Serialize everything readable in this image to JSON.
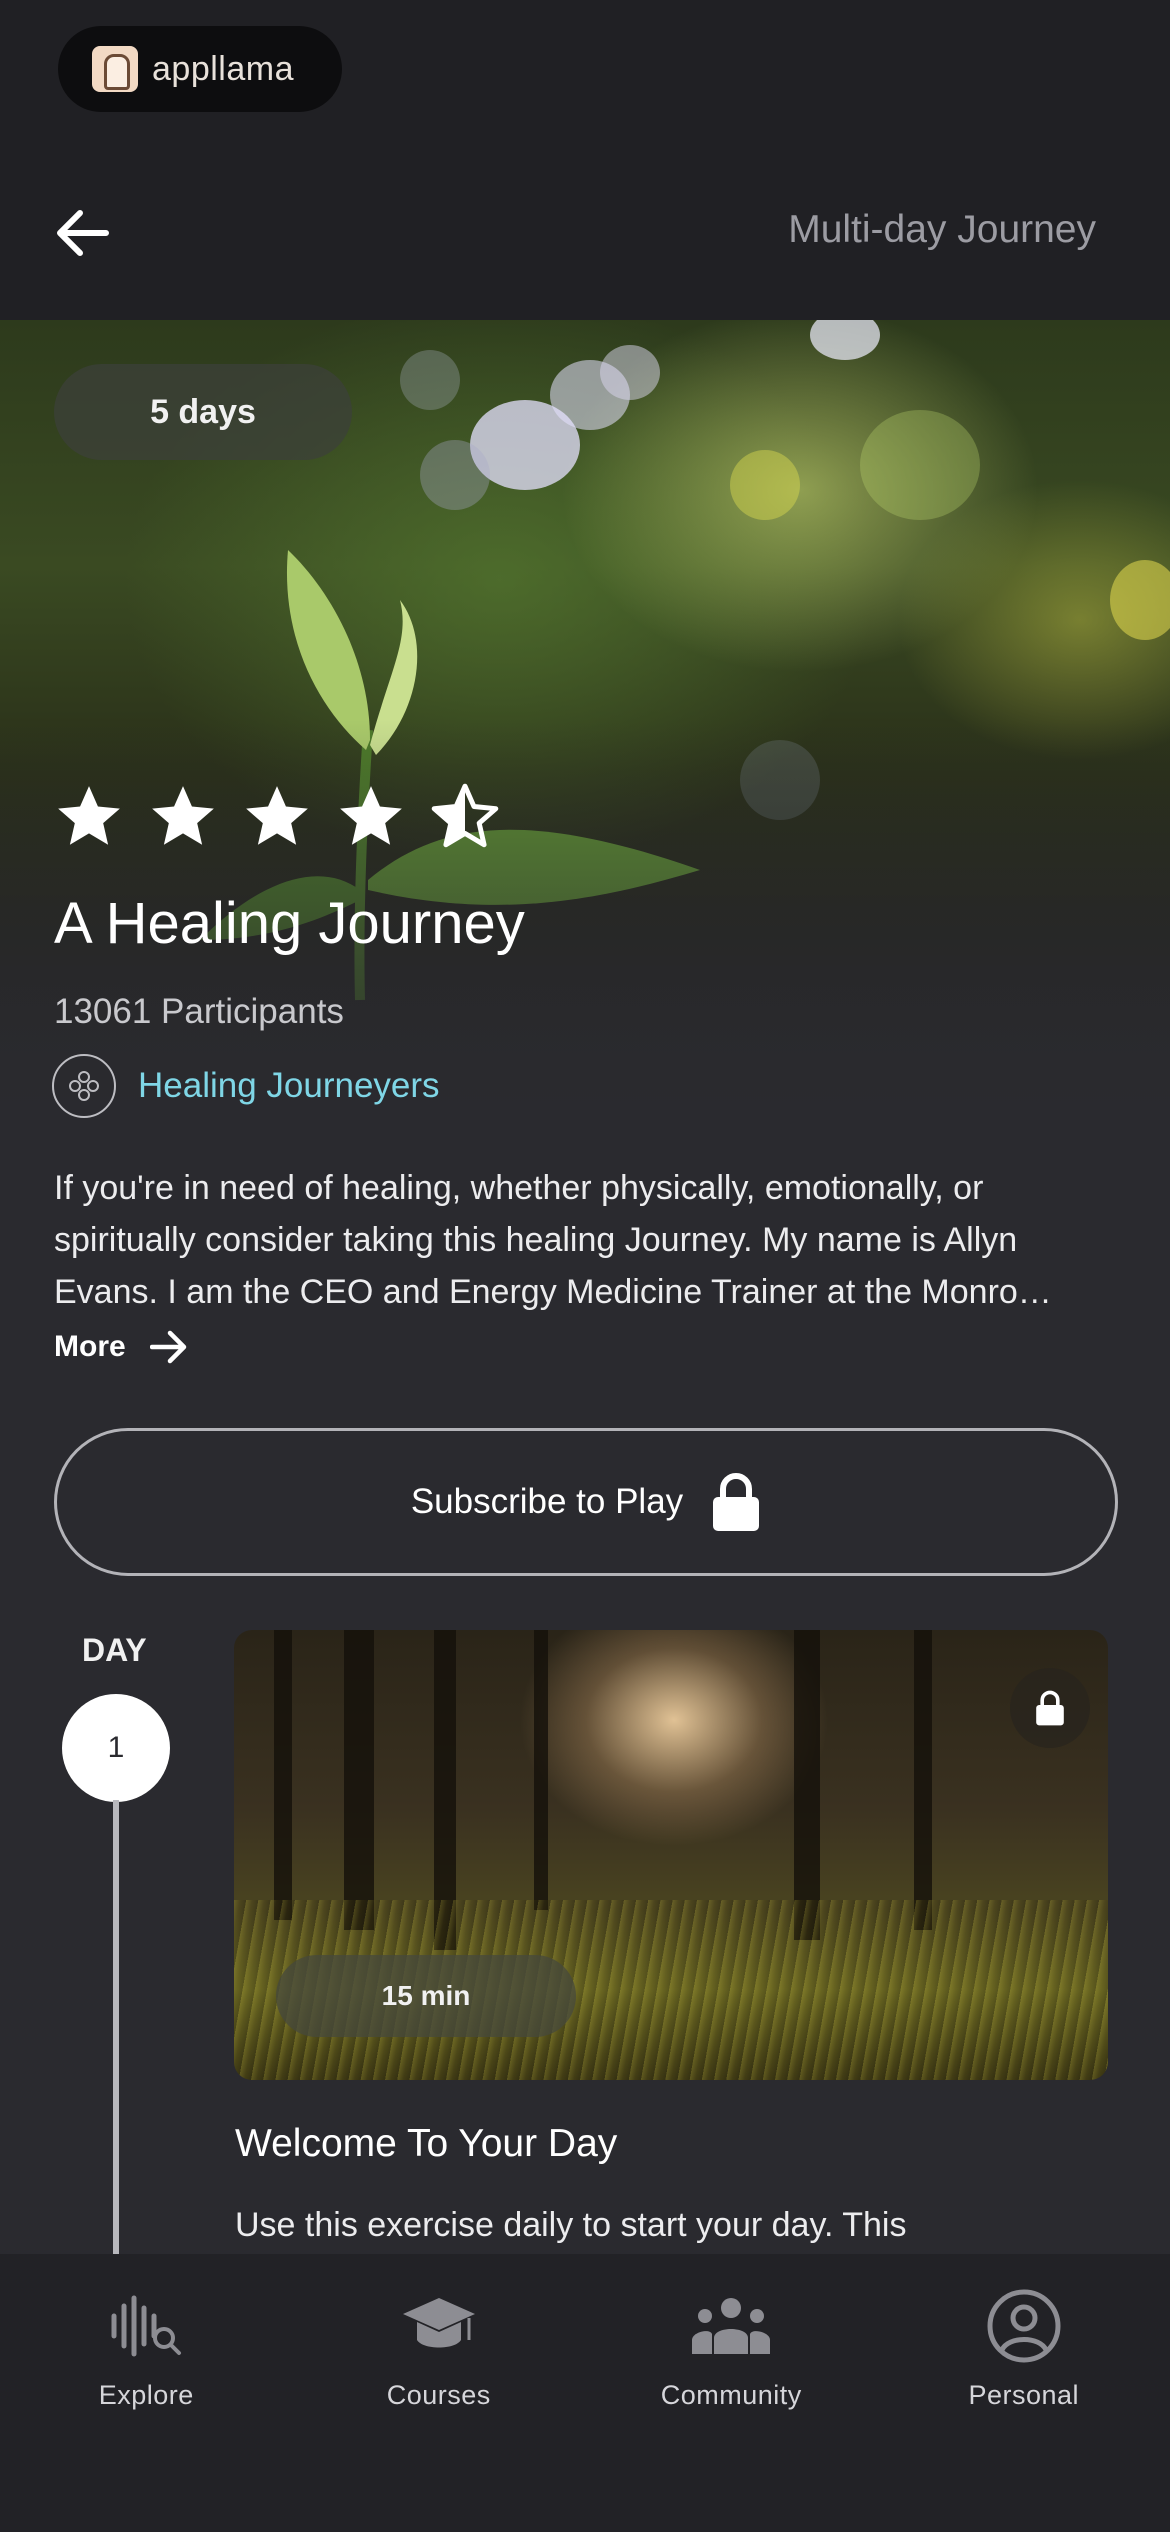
{
  "app": {
    "logo_text": "appllama"
  },
  "header": {
    "page_type": "Multi-day Journey"
  },
  "journey": {
    "duration_badge": "5 days",
    "rating": 4.5,
    "rating_max": 5,
    "title": "A Healing Journey",
    "participants": "13061 Participants",
    "author": "Healing Journeyers",
    "description": "If you're in need of healing, whether physically, emotionally, or spiritually consider taking this healing Journey. My name is Allyn Evans. I am the CEO and Energy Medicine Trainer at the Monro…",
    "more_label": "More",
    "subscribe_label": "Subscribe to Play"
  },
  "day": {
    "label": "DAY",
    "number": "1",
    "lesson": {
      "duration": "15 min",
      "title": "Welcome To Your Day",
      "description": "Use this exercise daily to start your day. This"
    }
  },
  "nav": {
    "items": [
      {
        "label": "Explore",
        "icon": "explore-icon"
      },
      {
        "label": "Courses",
        "icon": "graduation-cap-icon"
      },
      {
        "label": "Community",
        "icon": "community-icon"
      },
      {
        "label": "Personal",
        "icon": "person-icon"
      }
    ]
  },
  "colors": {
    "background": "#2a2a2f",
    "topbar": "#202024",
    "accent_link": "#7fd6e6",
    "nav_background": "#222226"
  }
}
